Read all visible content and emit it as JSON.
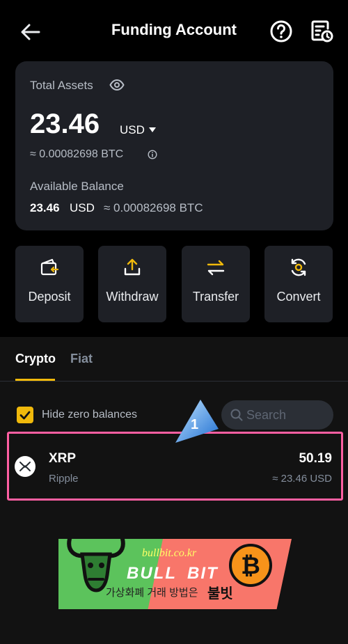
{
  "header": {
    "title": "Funding Account",
    "back_icon": "arrow-left-icon",
    "help_icon": "question-circle-icon",
    "history_icon": "document-clock-icon"
  },
  "assets_card": {
    "total_label": "Total Assets",
    "eye_icon": "eye-icon",
    "total_amount": "23.46",
    "currency": "USD",
    "btc_equivalent": "≈ 0.00082698 BTC",
    "info_icon": "info-icon",
    "available_label": "Available Balance",
    "available_amount": "23.46",
    "available_currency": "USD",
    "available_btc": "≈ 0.00082698 BTC"
  },
  "actions": [
    {
      "label": "Deposit",
      "icon": "deposit-icon"
    },
    {
      "label": "Withdraw",
      "icon": "withdraw-icon"
    },
    {
      "label": "Transfer",
      "icon": "transfer-icon"
    },
    {
      "label": "Convert",
      "icon": "convert-icon"
    }
  ],
  "tabs": {
    "crypto": "Crypto",
    "fiat": "Fiat",
    "active": "Crypto"
  },
  "filters": {
    "hide_zero_label": "Hide zero balances",
    "hide_zero_checked": true,
    "search_placeholder": "Search",
    "search_value": ""
  },
  "annotation": {
    "number": "1"
  },
  "assets": [
    {
      "symbol": "XRP",
      "name": "Ripple",
      "amount": "50.19",
      "usd_value": "≈ 23.46 USD",
      "icon": "xrp-icon"
    }
  ],
  "banner": {
    "url": "bullbit.co.kr",
    "word1": "BULL",
    "word2": "BIT",
    "subtitle": "가상화폐 거래 방법은",
    "subtitle_emphasis": "불빗"
  },
  "colors": {
    "accent": "#f0b90b",
    "card_bg": "#1e2026",
    "highlight_border": "#ff5fa2",
    "annotation_blue": "#3a8ee6"
  }
}
